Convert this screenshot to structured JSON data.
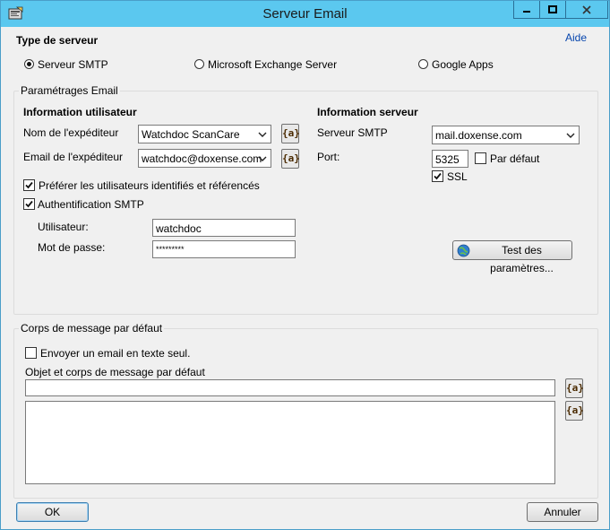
{
  "window": {
    "title": "Serveur Email"
  },
  "server_type": {
    "heading": "Type de serveur",
    "help_link": "Aide",
    "options": [
      {
        "label": "Serveur SMTP",
        "selected": true
      },
      {
        "label": "Microsoft Exchange Server",
        "selected": false
      },
      {
        "label": "Google Apps",
        "selected": false
      }
    ]
  },
  "email_settings": {
    "group_label": "Paramétrages Email",
    "user_info": {
      "heading": "Information utilisateur",
      "sender_name_label": "Nom de l'expéditeur",
      "sender_name_value": "Watchdoc ScanCare",
      "sender_email_label": "Email de l'expéditeur",
      "sender_email_value": "watchdoc@doxense.com",
      "prefer_identified_label": "Préférer les utilisateurs identifiés et référencés",
      "prefer_identified_checked": true,
      "smtp_auth_label": "Authentification SMTP",
      "smtp_auth_checked": true,
      "username_label": "Utilisateur:",
      "username_value": "watchdoc",
      "password_label": "Mot de passe:",
      "password_value": "*********"
    },
    "server_info": {
      "heading": "Information serveur",
      "smtp_server_label": "Serveur SMTP",
      "smtp_server_value": "mail.doxense.com",
      "port_label": "Port:",
      "port_value": "5325",
      "default_label": "Par défaut",
      "default_checked": false,
      "ssl_label": "SSL",
      "ssl_checked": true,
      "test_button_label": "Test des paramètres..."
    },
    "variable_button_label": "{a}"
  },
  "default_message": {
    "group_label": "Corps de message par défaut",
    "plain_text_label": "Envoyer un email en texte seul.",
    "plain_text_checked": false,
    "subject_body_label": "Objet et corps de message par défaut",
    "subject_value": "",
    "body_value": ""
  },
  "buttons": {
    "ok": "OK",
    "cancel": "Annuler"
  },
  "colors": {
    "titlebar": "#5bc8ef",
    "client": "#f0f0f0",
    "link": "#0645ad"
  }
}
